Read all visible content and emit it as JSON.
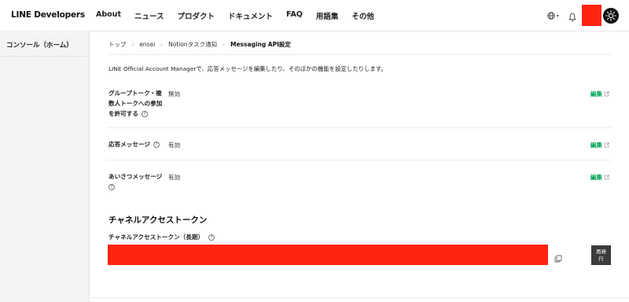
{
  "header": {
    "logo": "LINE Developers",
    "nav": [
      "About",
      "ニュース",
      "プロダクト",
      "ドキュメント",
      "FAQ",
      "用語集",
      "その他"
    ],
    "lang_caret": "▾",
    "avatar_color": "#ff2410"
  },
  "sidebar": {
    "items": [
      {
        "label": "コンソール（ホーム）"
      }
    ]
  },
  "breadcrumb": [
    "トップ",
    "ensei",
    "Notionタスク通知",
    "Messaging API設定"
  ],
  "description": "LINE Official Account Managerで、応答メッセージを編集したり、そのほかの機能を設定したりします。",
  "settings": [
    {
      "label_lines": [
        "グループトーク・複",
        "数人トークへの参加",
        "を許可する"
      ],
      "value": "無効",
      "edit": "編集"
    },
    {
      "label_lines": [
        "応答メッセージ"
      ],
      "value": "有効",
      "edit": "編集"
    },
    {
      "label_lines": [
        "あいさつメッセージ"
      ],
      "value": "有効",
      "edit": "編集"
    }
  ],
  "help_glyph": "?",
  "token": {
    "section_title": "チャネルアクセストークン",
    "label": "チャネルアクセストークン（長期）",
    "reissue_lines": [
      "再発",
      "行"
    ],
    "redaction_color": "#ff2410"
  },
  "colors": {
    "accent_green": "#06a55a",
    "button_dark": "#3b3b3b"
  },
  "icons": [
    "globe-icon",
    "bell-icon",
    "sun-icon",
    "help-icon",
    "external-link-icon",
    "copy-icon",
    "chevron-right-icon"
  ]
}
